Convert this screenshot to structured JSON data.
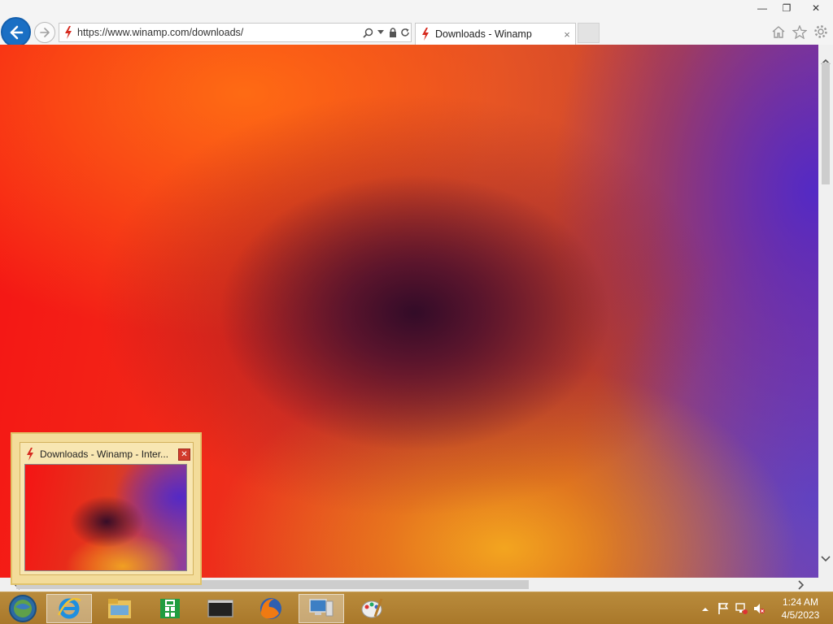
{
  "browser": {
    "address_url": "https://www.winamp.com/downloads/",
    "tab_title": "Downloads - Winamp",
    "tab_close": "×"
  },
  "window_controls": {
    "minimize": "—",
    "restore": "❐",
    "close": "✕"
  },
  "thumbnail": {
    "title": "Downloads - Winamp - Inter...",
    "close": "✕"
  },
  "taskbar": {
    "items": [
      {
        "name": "start-orb-icon"
      },
      {
        "name": "internet-explorer-icon"
      },
      {
        "name": "file-explorer-icon"
      },
      {
        "name": "store-icon"
      },
      {
        "name": "command-prompt-icon"
      },
      {
        "name": "firefox-icon"
      },
      {
        "name": "remote-desktop-icon"
      },
      {
        "name": "paint-icon"
      }
    ]
  },
  "clock": {
    "time": "1:24 AM",
    "date": "4/5/2023"
  },
  "colors": {
    "accent_blue": "#1a6fc4",
    "taskbar": "#b98b3c",
    "thumbnail_bg": "#f3dc9a",
    "winamp_red": "#d62b20"
  }
}
